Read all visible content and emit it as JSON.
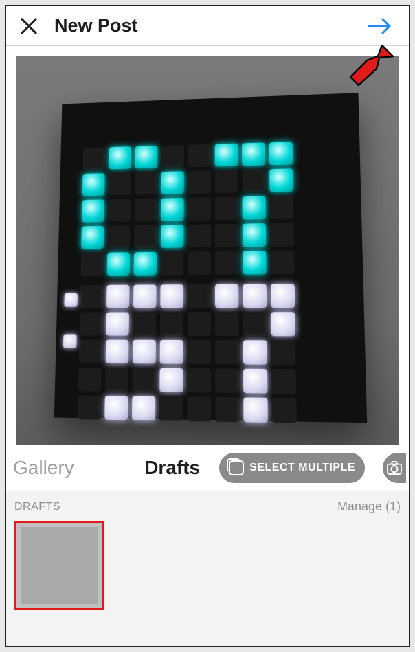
{
  "header": {
    "title": "New Post",
    "close_label": "Close",
    "next_label": "Next"
  },
  "preview": {
    "clock_top": "07",
    "clock_bottom": "57",
    "colors": {
      "cyan": "#00d6d6",
      "white": "#d8d8f0"
    }
  },
  "tabs": {
    "gallery": "Gallery",
    "drafts": "Drafts",
    "select_multiple": "SELECT MULTIPLE",
    "camera_label": "Camera"
  },
  "drafts_section": {
    "title": "DRAFTS",
    "manage_label": "Manage (1)",
    "count": 1,
    "items": [
      {
        "id": "draft-1",
        "selected": true
      }
    ]
  },
  "annotation": {
    "type": "arrow",
    "target": "next-button",
    "color": "#e11a1a"
  }
}
